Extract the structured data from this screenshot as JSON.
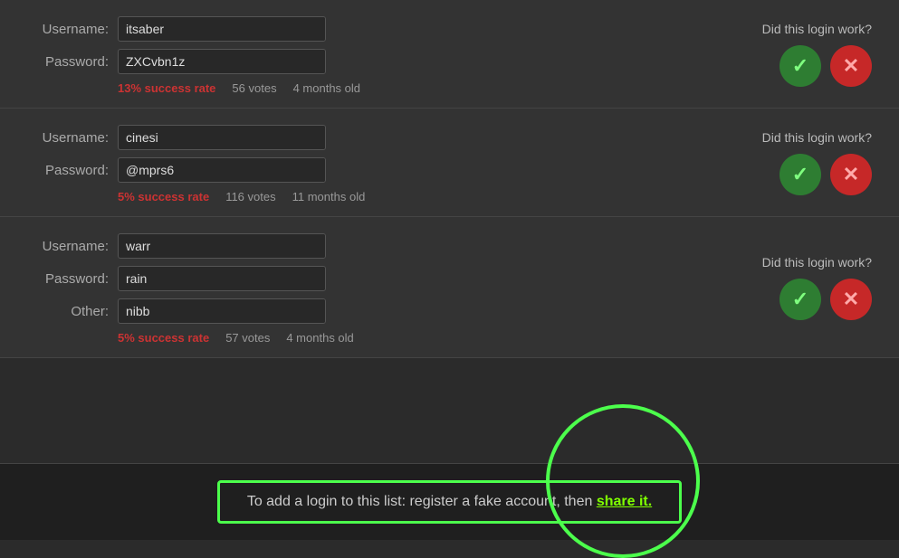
{
  "cards": [
    {
      "id": "card-1",
      "username_label": "Username:",
      "password_label": "Password:",
      "username_value": "itsaber",
      "password_value": "ZXCvbn1z",
      "success_rate": "13% success rate",
      "votes": "56 votes",
      "age": "4 months old",
      "did_this_work": "Did this login work?",
      "yes_label": "Yes",
      "no_label": "No",
      "has_other": false
    },
    {
      "id": "card-2",
      "username_label": "Username:",
      "password_label": "Password:",
      "username_value": "cinesi",
      "password_value": "@mprs6",
      "success_rate": "5% success rate",
      "votes": "116 votes",
      "age": "11 months old",
      "did_this_work": "Did this login work?",
      "yes_label": "Yes",
      "no_label": "No",
      "has_other": false
    },
    {
      "id": "card-3",
      "username_label": "Username:",
      "password_label": "Password:",
      "other_label": "Other:",
      "username_value": "warr",
      "password_value": "rain",
      "other_value": "nibb",
      "success_rate": "5% success rate",
      "votes": "57 votes",
      "age": "4 months old",
      "did_this_work": "Did this login work?",
      "yes_label": "Yes",
      "no_label": "No",
      "has_other": true
    }
  ],
  "bottom_bar": {
    "text_before": "To add a login to this list: register a fake acco",
    "text_middle": "then ",
    "share_text": "share it.",
    "full_text": "To add a login to this list: register a fake account, then share it."
  }
}
